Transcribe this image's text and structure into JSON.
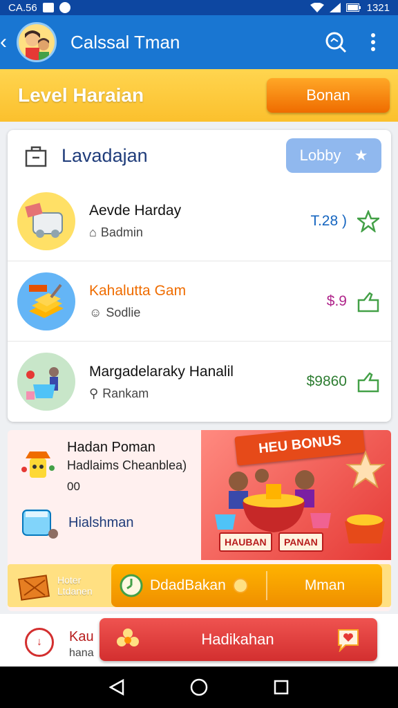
{
  "status_bar": {
    "time_left": "CA.56",
    "time_right": "1321"
  },
  "app_bar": {
    "title": "Calssal Tman"
  },
  "level": {
    "title": "Level Haraian",
    "button": "Bonan"
  },
  "list": {
    "title": "Lavadajan",
    "lobby_button": "Lobby",
    "items": [
      {
        "name": "Aevde Harday",
        "sub": "Badmin",
        "price": "T.28 )",
        "price_color": "#1565c0"
      },
      {
        "name": "Kahalutta Gam",
        "sub": "Sodlie",
        "price": "$.9",
        "price_color": "#b0268b"
      },
      {
        "name": "Margadelaraky Hanalil",
        "sub": "Rankam",
        "price": "$9860",
        "price_color": "#2e7d32"
      }
    ]
  },
  "promo": {
    "title": "Hadan Poman",
    "desc": "Hadlaims Cheanblea)",
    "count": "00",
    "link": "Hialshman",
    "ribbon": "HEU BONUS",
    "tag1": "HAUBAN",
    "tag2": "PANAN"
  },
  "bar": {
    "left_line1": "Hoter",
    "left_line2": "Ltdanen",
    "seg1": "DdadBakan",
    "seg2": "Mman"
  },
  "bottom": {
    "line1": "Kau",
    "line2": "hana",
    "button": "Hadikahan"
  },
  "colors": {
    "appbar": "#1976d2",
    "level": "#fbc02d",
    "accent_orange": "#ef6c00",
    "accent_red": "#d32f2f"
  }
}
